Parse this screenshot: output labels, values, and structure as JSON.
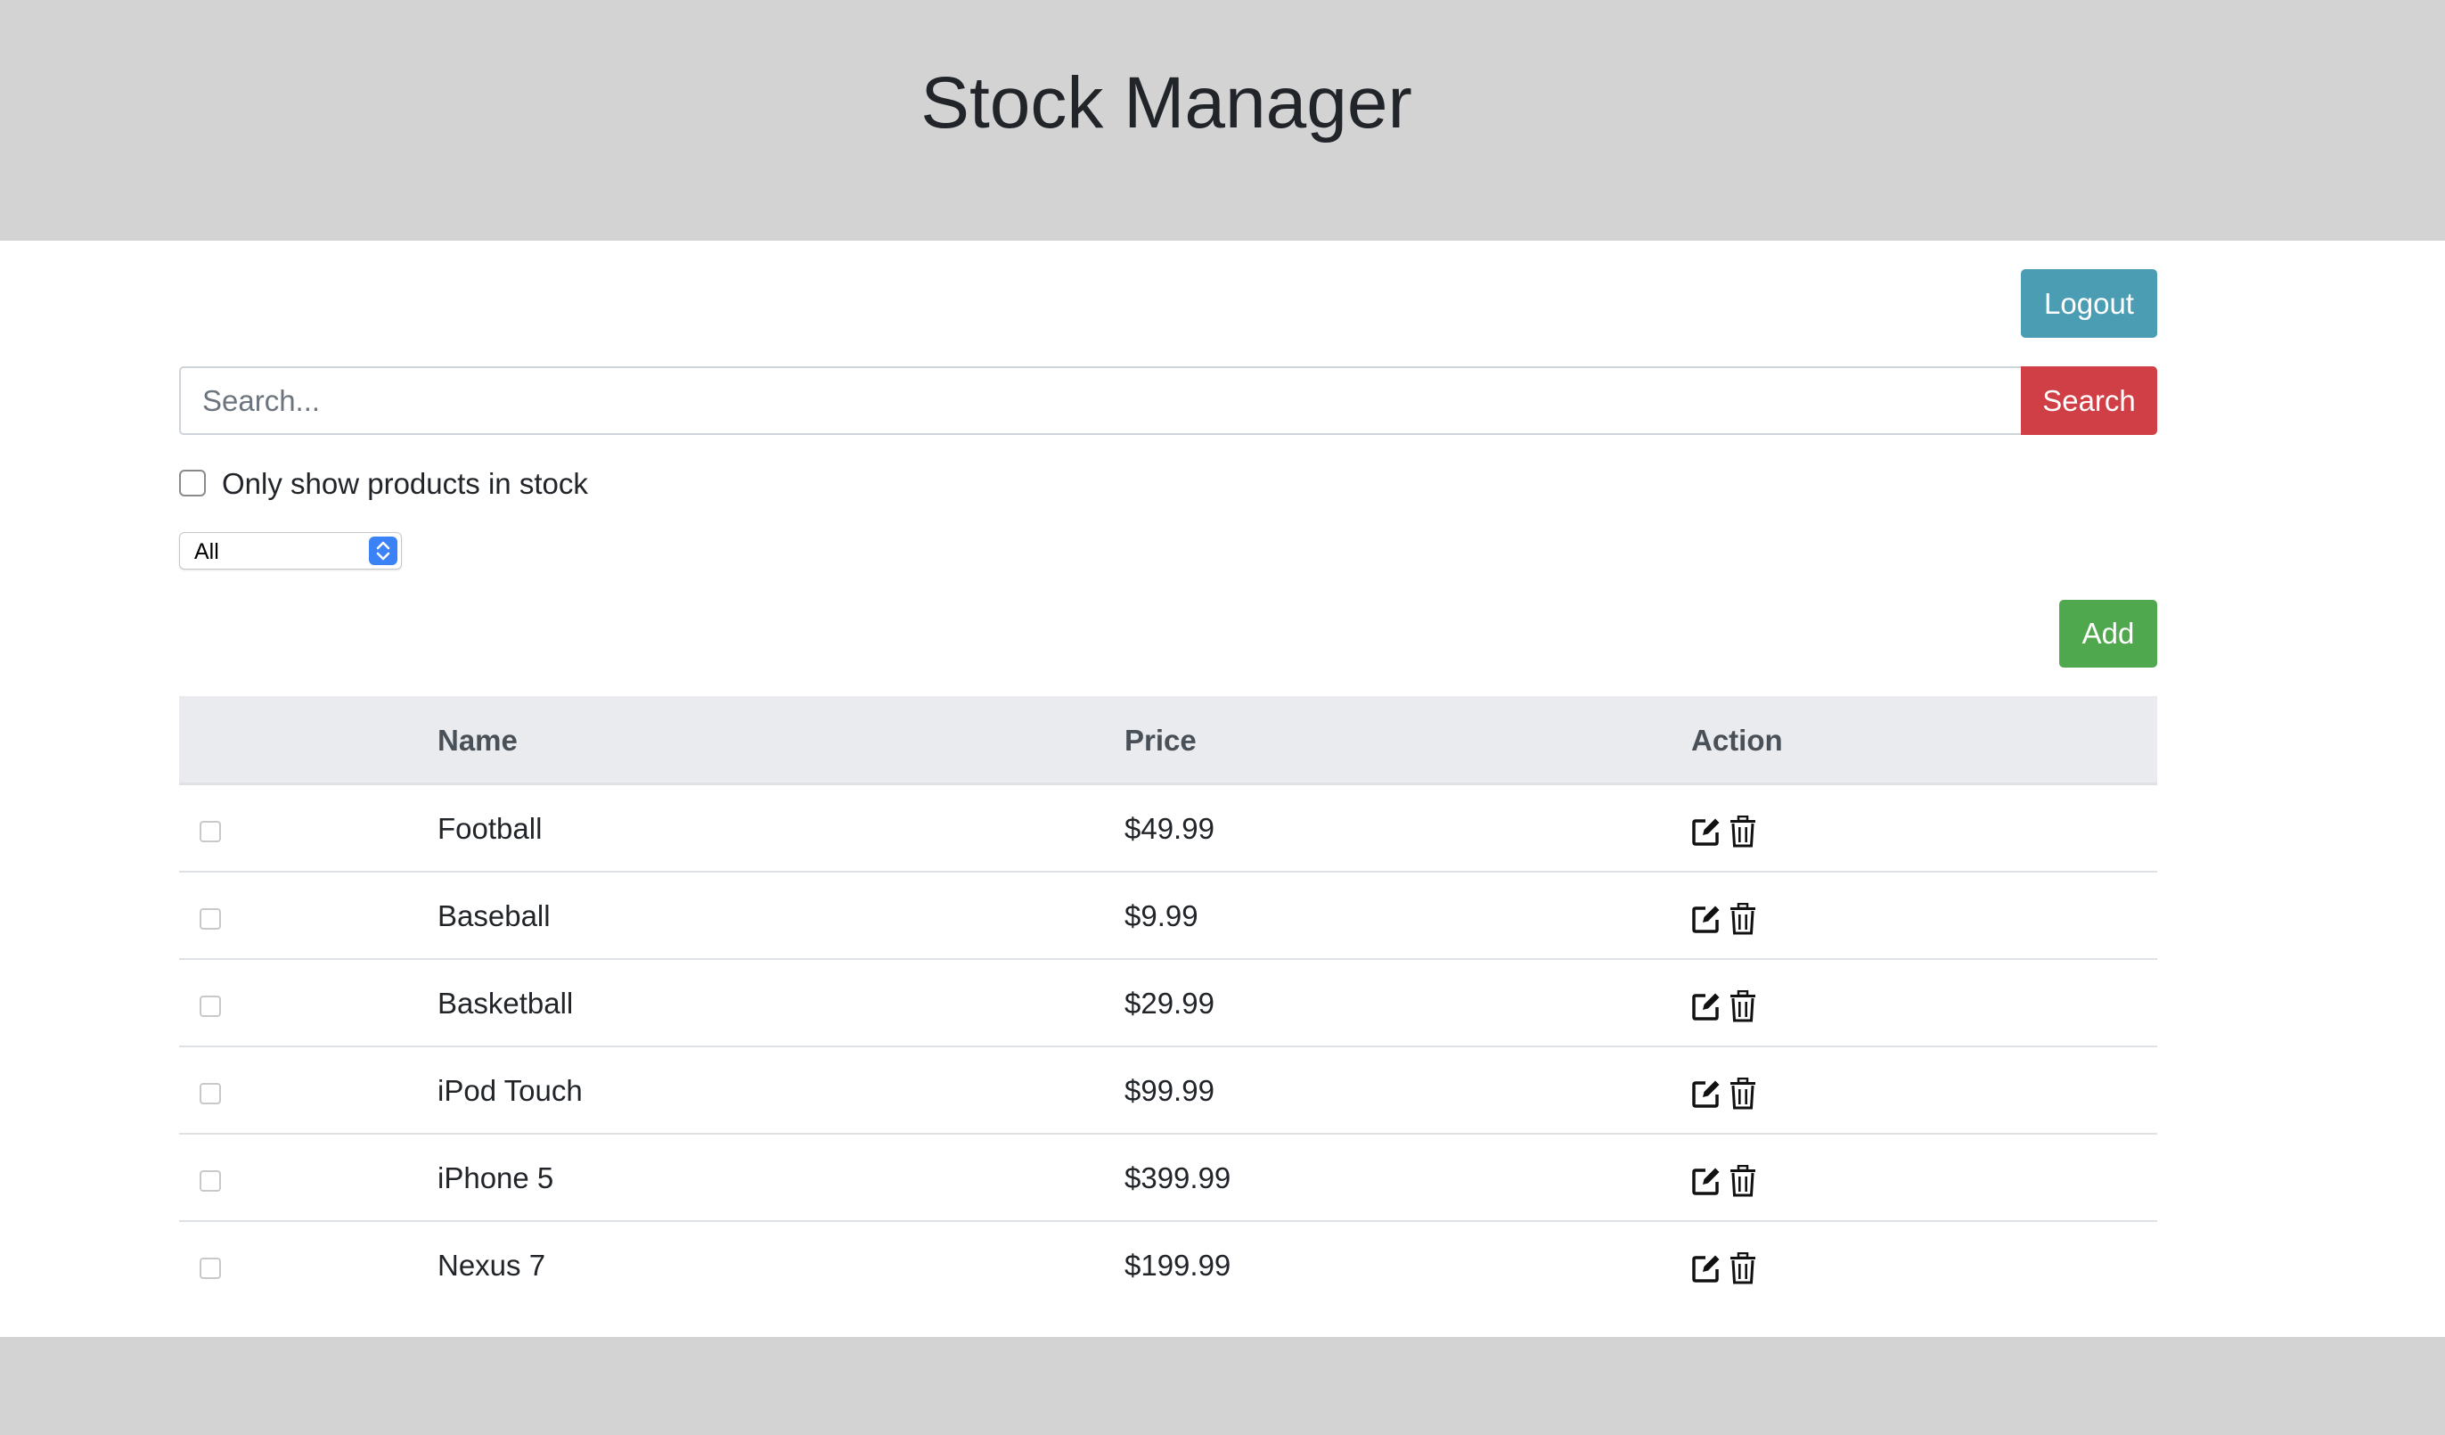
{
  "header": {
    "title": "Stock Manager"
  },
  "toolbar": {
    "logout_label": "Logout",
    "add_label": "Add"
  },
  "search": {
    "placeholder": "Search...",
    "value": "",
    "button_label": "Search"
  },
  "filters": {
    "in_stock_label": "Only show products in stock",
    "in_stock_checked": false,
    "category_selected": "All"
  },
  "table": {
    "columns": {
      "name": "Name",
      "price": "Price",
      "action": "Action"
    },
    "rows": [
      {
        "name": "Football",
        "price": "$49.99"
      },
      {
        "name": "Baseball",
        "price": "$9.99"
      },
      {
        "name": "Basketball",
        "price": "$29.99"
      },
      {
        "name": "iPod Touch",
        "price": "$99.99"
      },
      {
        "name": "iPhone 5",
        "price": "$399.99"
      },
      {
        "name": "Nexus 7",
        "price": "$199.99"
      }
    ],
    "row_icons": [
      "edit-icon",
      "trash-icon"
    ]
  },
  "colors": {
    "header_bg": "#d3d3d3",
    "logout": "#4a9db3",
    "search": "#cf3f45",
    "add": "#4fa84e",
    "table_head_bg": "#e9ebee"
  }
}
